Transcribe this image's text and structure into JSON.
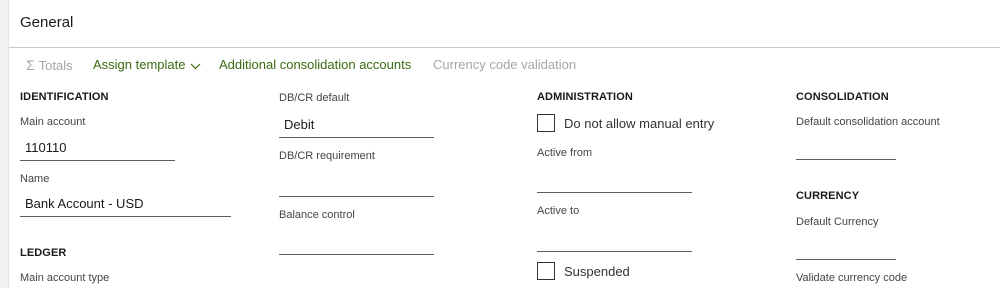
{
  "section": {
    "title": "General"
  },
  "toolbar": {
    "totals_label": "Totals",
    "assign_template_label": "Assign template",
    "additional_consolidation_label": "Additional consolidation accounts",
    "currency_code_validation_label": "Currency code validation"
  },
  "identification": {
    "title": "IDENTIFICATION",
    "main_account_label": "Main account",
    "main_account_value": "110110",
    "name_label": "Name",
    "name_value": "Bank Account - USD"
  },
  "ledger": {
    "title": "LEDGER",
    "main_account_type_label": "Main account type"
  },
  "dbcr": {
    "default_label": "DB/CR default",
    "default_value": "Debit",
    "requirement_label": "DB/CR requirement",
    "requirement_value": "",
    "balance_control_label": "Balance control",
    "balance_control_value": ""
  },
  "administration": {
    "title": "ADMINISTRATION",
    "no_manual_entry_label": "Do not allow manual entry",
    "no_manual_entry_checked": false,
    "active_from_label": "Active from",
    "active_from_value": "",
    "active_to_label": "Active to",
    "active_to_value": "",
    "suspended_label": "Suspended",
    "suspended_checked": false
  },
  "consolidation": {
    "title": "CONSOLIDATION",
    "default_account_label": "Default consolidation account",
    "default_account_value": ""
  },
  "currency": {
    "title": "CURRENCY",
    "default_currency_label": "Default Currency",
    "default_currency_value": "",
    "validate_label": "Validate currency code"
  },
  "colors": {
    "accent_green": "#3b6a12",
    "disabled_gray": "#a6a6a6",
    "border": "#c8c8c8"
  }
}
